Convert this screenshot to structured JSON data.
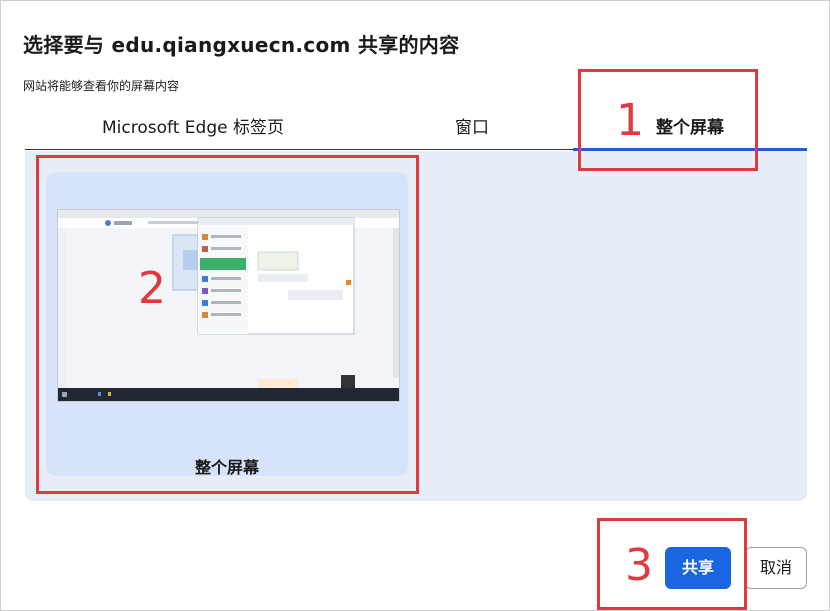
{
  "dialog": {
    "title": "选择要与 edu.qiangxuecn.com 共享的内容",
    "subtitle": "网站将能够查看你的屏幕内容"
  },
  "tabs": [
    {
      "label": "Microsoft Edge 标签页",
      "active": false
    },
    {
      "label": "窗口",
      "active": false
    },
    {
      "label": "整个屏幕",
      "active": true
    }
  ],
  "screen_option": {
    "label": "整个屏幕"
  },
  "buttons": {
    "share": "共享",
    "cancel": "取消"
  },
  "annotations": {
    "n1": "1",
    "n2": "2",
    "n3": "3"
  },
  "colors": {
    "accent": "#1a66e0",
    "annotation": "#e0393f",
    "panel": "#e8eef8",
    "card": "#d6e3fb"
  }
}
